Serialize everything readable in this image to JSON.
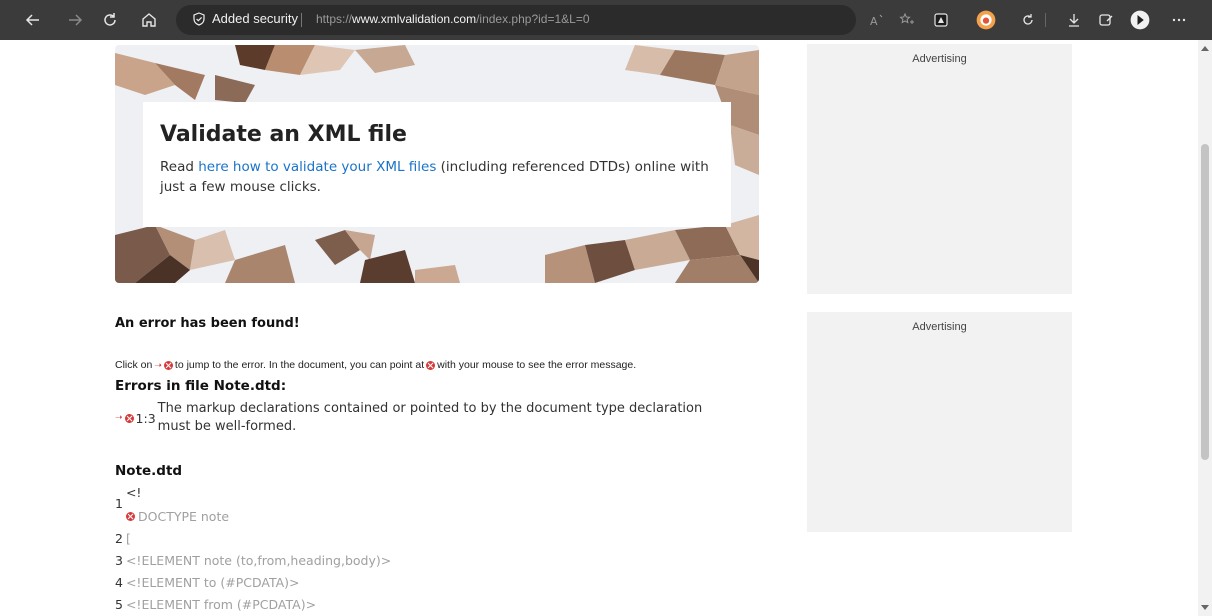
{
  "browser": {
    "security_label": "Added security",
    "url_prefix": "https://",
    "url_domain": "www.xmlvalidation.com",
    "url_path": "/index.php?id=1&L=0"
  },
  "hero": {
    "title": "Validate an XML file",
    "text_before": "Read ",
    "link": "here how to validate your XML files",
    "text_after": " (including referenced DTDs) online with just a few mouse clicks."
  },
  "ads": [
    "Advertising",
    "Advertising"
  ],
  "result": {
    "error_found": "An error has been found!",
    "hint_a": "Click on",
    "hint_b": "to jump to the error. In the document, you can point at",
    "hint_c": "with your mouse to see the error message.",
    "errors_title": "Errors in file Note.dtd:",
    "error_pos": "1:3",
    "error_msg": "The markup declarations contained or pointed to by the document type declaration must be well-formed."
  },
  "file": {
    "title": "Note.dtd",
    "lines": [
      {
        "n": "1",
        "a": "<!",
        "b": "DOCTYPE note"
      },
      {
        "n": "2",
        "t": "["
      },
      {
        "n": "3",
        "t": "<!ELEMENT note (to,from,heading,body)>"
      },
      {
        "n": "4",
        "t": "<!ELEMENT to (#PCDATA)>"
      },
      {
        "n": "5",
        "t": "<!ELEMENT from (#PCDATA)>"
      }
    ]
  },
  "colors": {
    "chrome": "#3b3b3b",
    "link": "#1a73c8",
    "error": "#d63a3a",
    "ad_bg": "#f2f2f2"
  }
}
